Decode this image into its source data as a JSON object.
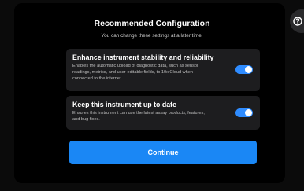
{
  "dialog": {
    "title": "Recommended Configuration",
    "subtitle": "You can change these settings at a later time."
  },
  "settings": [
    {
      "title": "Enhance instrument stability and reliability",
      "description": "Enables the automatic upload of diagnostic data, such as sensor readings, metrics, and user-editable fields, to 10x Cloud when connected to the internet.",
      "enabled": true
    },
    {
      "title": "Keep this instrument up to date",
      "description": "Ensures this instrument can use the latest assay products, features, and bug fixes.",
      "enabled": true
    }
  ],
  "actions": {
    "continue_label": "Continue"
  },
  "colors": {
    "accent": "#1a87f5",
    "toggle_on": "#2f8cff",
    "card_bg": "#1d1d1f",
    "background": "#000000"
  },
  "icons": {
    "corner": "help-icon"
  }
}
